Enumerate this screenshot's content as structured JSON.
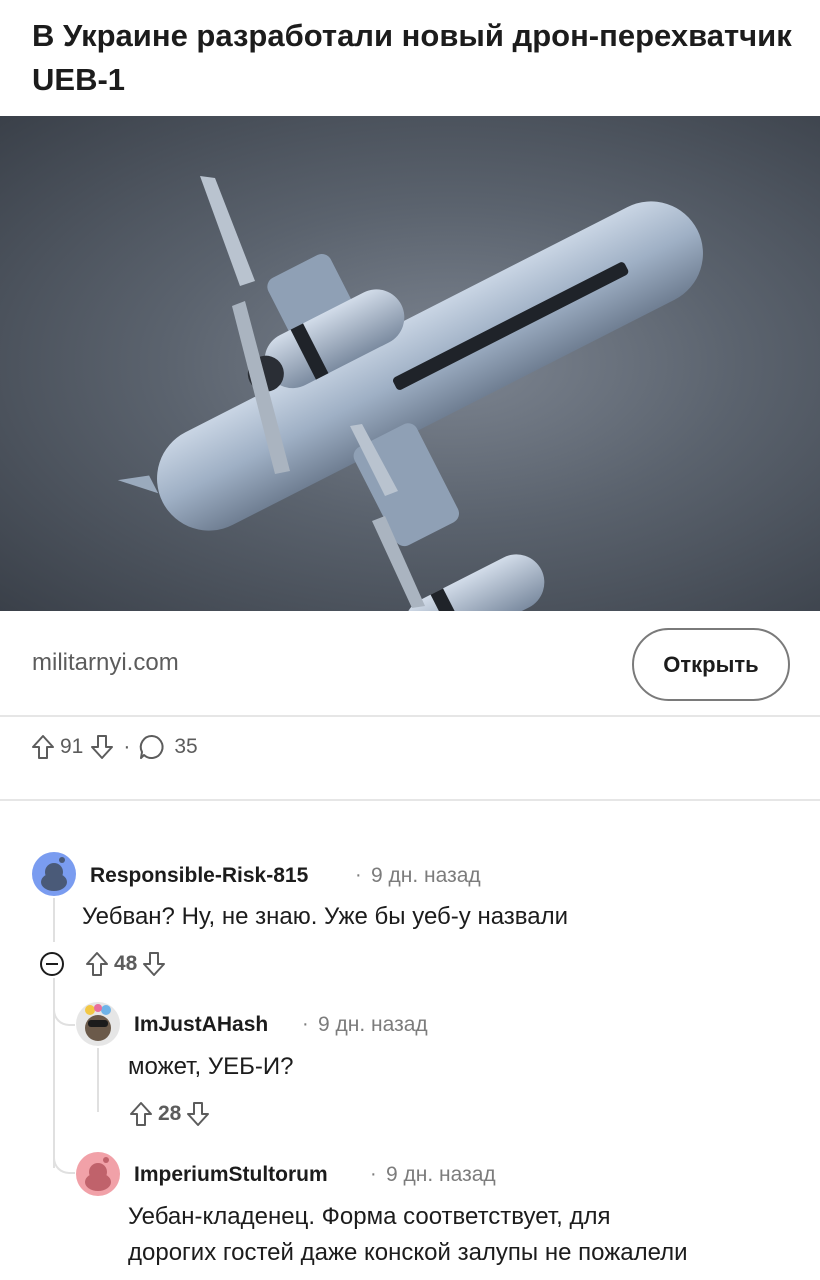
{
  "post": {
    "title": "В Украине разработали новый дрон-перехватчик UEB-1",
    "domain": "militarnyi.com",
    "open_label": "Открыть",
    "upvotes": "91",
    "comments_count": "35"
  },
  "comments": [
    {
      "author": "Responsible-Risk-815",
      "time": "9 дн. назад",
      "body": "Уебван? Ну, не знаю. Уже бы уеб-у назвали",
      "score": "48",
      "avatar_color": "#7a9cf0"
    },
    {
      "author": "ImJustAHash",
      "time": "9 дн. назад",
      "body": "может, УЕБ-И?",
      "score": "28",
      "avatar_color": "#d9d9d9"
    },
    {
      "author": "ImperiumStultorum",
      "time": "9 дн. назад",
      "body_line1": "Уебан-кладенец. Форма соответствует, для",
      "body_line2": "дорогих гостей даже конской залупы не пожалели",
      "avatar_color": "#f1a1a8"
    }
  ],
  "separator": "·",
  "icons": {
    "upvote": "arrow-up-icon",
    "downvote": "arrow-down-icon",
    "comment": "speech-bubble-icon",
    "collapse": "minus-circle-icon"
  }
}
